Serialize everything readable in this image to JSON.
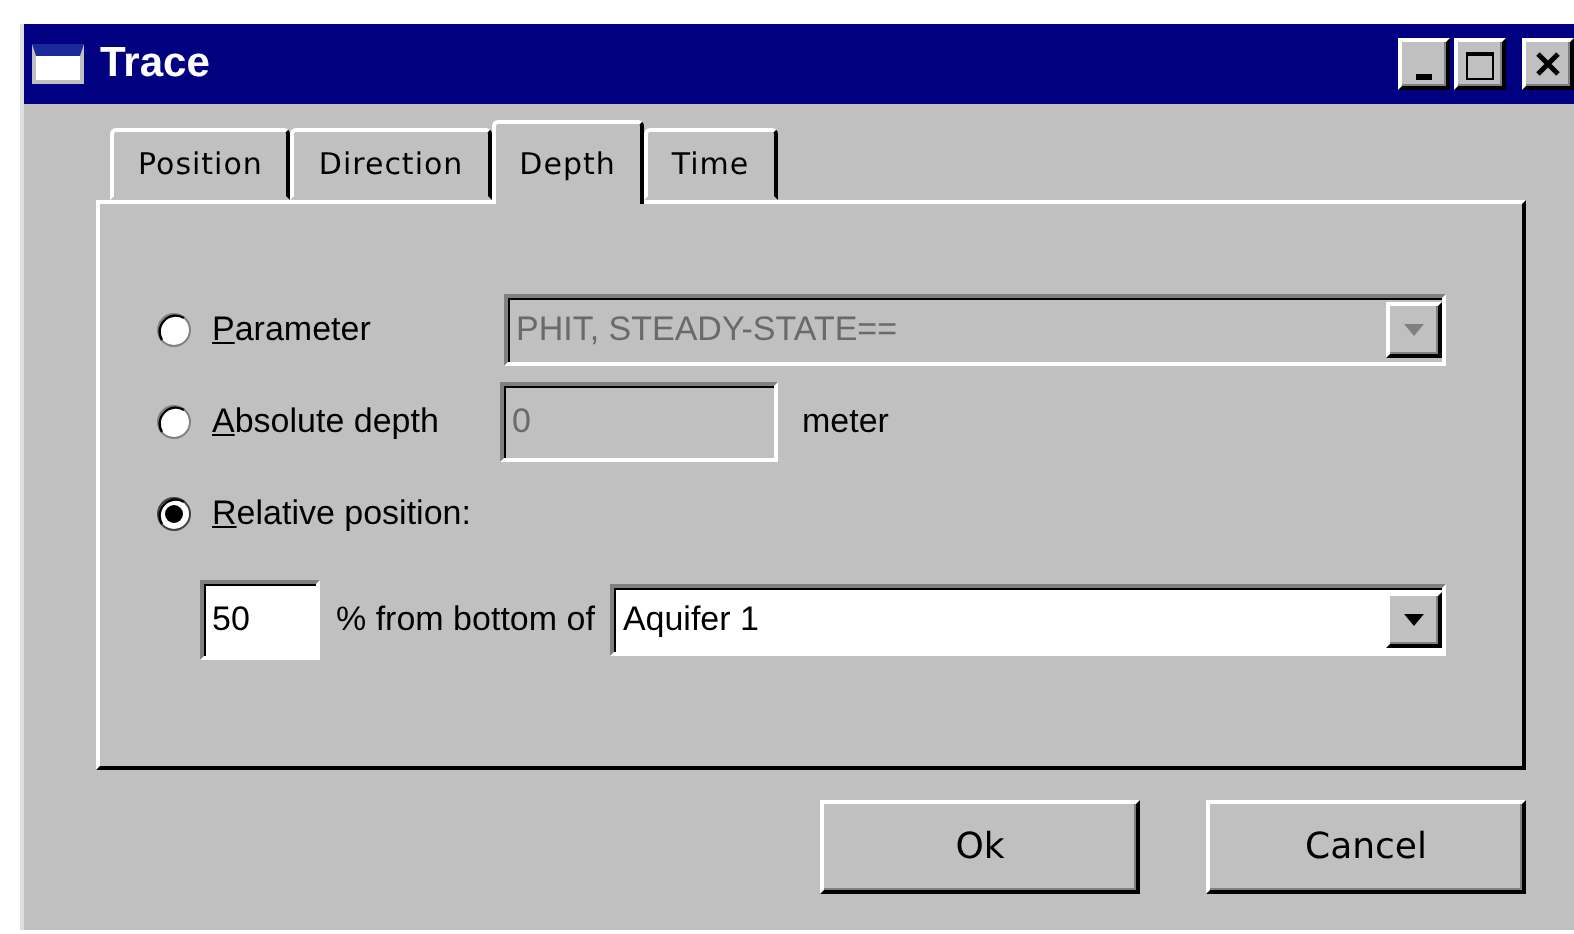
{
  "window": {
    "title": "Trace"
  },
  "tabs": [
    {
      "label": "Position",
      "selected": false
    },
    {
      "label": "Direction",
      "selected": false
    },
    {
      "label": "Depth",
      "selected": true
    },
    {
      "label": "Time",
      "selected": false
    }
  ],
  "options": [
    {
      "kind": "combo",
      "label": "Parameter",
      "selected": false,
      "value": "PHIT, STEADY-STATE==",
      "disabled": true
    },
    {
      "kind": "field",
      "label": "Absolute depth",
      "selected": false,
      "value": "0",
      "unit": "meter",
      "disabled": true
    },
    {
      "kind": "plain",
      "label": "Relative position:",
      "selected": true
    }
  ],
  "relative": {
    "percent": "50",
    "text": "% from bottom of",
    "layer": "Aquifer 1",
    "disabled": false
  },
  "buttons": [
    "Ok",
    "Cancel"
  ]
}
